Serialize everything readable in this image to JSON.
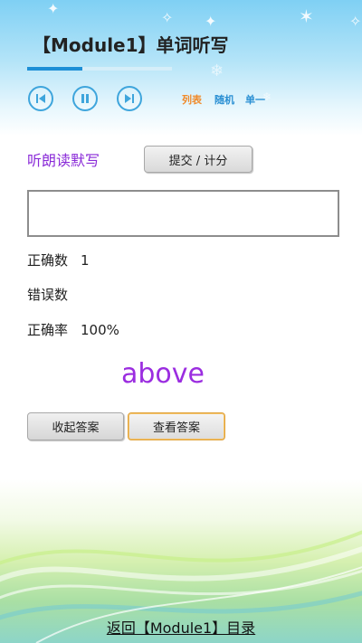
{
  "header": {
    "title": "【Module1】单词听写",
    "progress_fraction": 0.38
  },
  "controls": {
    "prev_icon": "skip-previous-icon",
    "pause_icon": "pause-icon",
    "next_icon": "skip-next-icon",
    "modes": [
      "列表",
      "随机",
      "单一"
    ]
  },
  "dictation": {
    "label": "听朗读默写",
    "submit_label": "提交 / 计分",
    "input_value": "",
    "input_placeholder": ""
  },
  "stats": {
    "correct_label": "正确数",
    "correct_value": "1",
    "wrong_label": "错误数",
    "wrong_value": "",
    "rate_label": "正确率",
    "rate_value": "100%"
  },
  "answer": {
    "word": "above",
    "collapse_label": "收起答案",
    "view_label": "查看答案"
  },
  "footer": {
    "link": "返回【Module1】目录"
  },
  "colors": {
    "accent": "#1e8fd6",
    "purple": "#9b2de0",
    "orange": "#f08a2a"
  }
}
